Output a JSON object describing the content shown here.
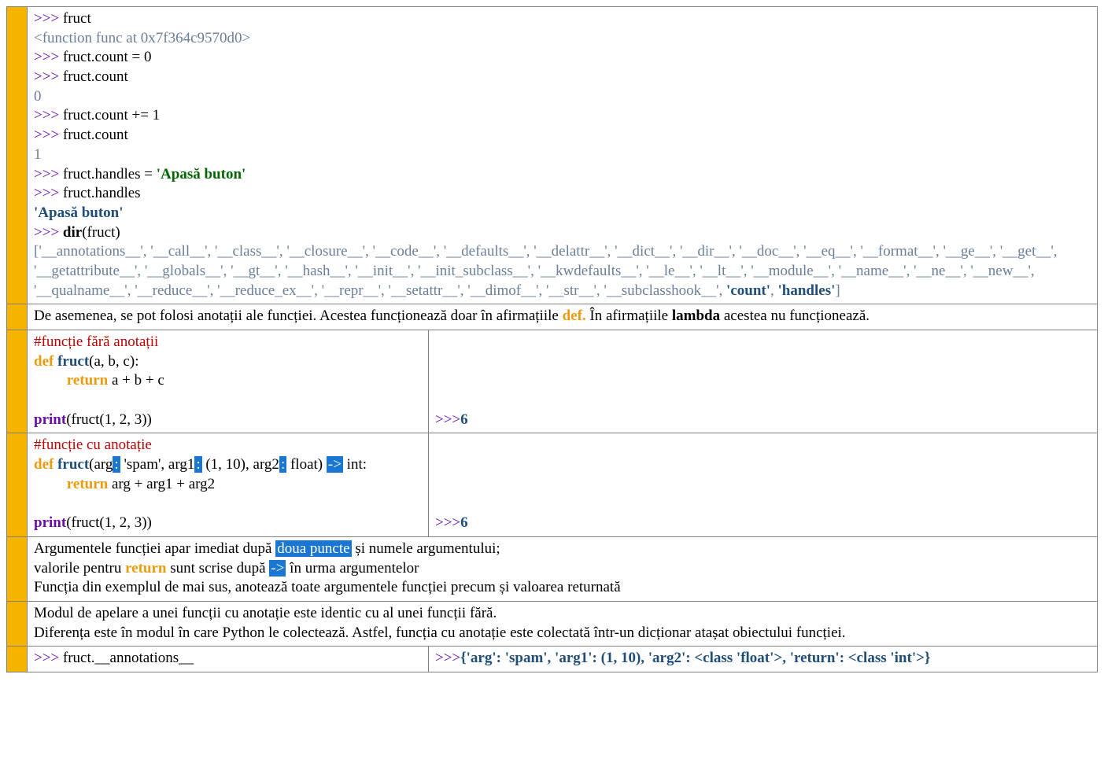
{
  "repl": {
    "l1_prompt": ">>> ",
    "l1_code": "fruct",
    "l2_out": "<function func at 0x7f364c9570d0>",
    "l3_prompt": ">>> ",
    "l3_code": "fruct.count = 0",
    "l4_prompt": ">>> ",
    "l4_code": "fruct.count",
    "l5_out": "0",
    "l6_prompt": ">>> ",
    "l6_code": "fruct.count += 1",
    "l7_prompt": ">>> ",
    "l7_code": "fruct.count",
    "l8_out": "1",
    "l9_prompt": ">>> ",
    "l9_code": "fruct.handles = ",
    "l9_str": "'Apasă buton'",
    "l10_prompt": ">>> ",
    "l10_code": "fruct.handles",
    "l11_out": "'Apasă buton'",
    "l12_prompt": ">>> ",
    "l12_dir": "dir",
    "l12_arg": "(fruct)",
    "dir_list_a": "['__annotations__', '__call__', '__class__', '__closure__', '__code__', '__defaults__', '__delattr__', '__dict__', '__dir__', '__doc__', '__eq__', '__format__', '__ge__', '__get__', '__getattribute__', '__globals__', '__gt__', '__hash__', '__init__', '__init_subclass__', '__kwdefaults__', '__le__', '__lt__', '__module__', '__name__', '__ne__', '__new__', '__qualname__', '__reduce__', '__reduce_ex__', '__repr__', '__setattr__', '__dimof__', '__str__', '__subclasshook__', ",
    "dir_count": "'count'",
    "dir_sep": ", ",
    "dir_handles": "'handles'",
    "dir_close": "]"
  },
  "row2": {
    "text_a": "De asemenea, se pot folosi anotații ale funcției. Acestea funcționează doar în afirmațiile ",
    "def": "def.",
    "text_b": " În afirmațiile ",
    "lambda": "lambda",
    "text_c": " acestea nu funcționează."
  },
  "row3": {
    "comment": "#funcție fără anotații",
    "def": "def ",
    "fn": "fruct",
    "args": "(a, b, c):",
    "ret": "return",
    "retexpr": " a + b + c",
    "print": "print",
    "printarg": "(fruct(1, 2, 3))",
    "out_prompt": ">>>",
    "out_val": "6"
  },
  "row4": {
    "comment": "#funcție cu anotație",
    "def": "def ",
    "fn": "fruct",
    "a_arg": "(arg",
    "colon1": ":",
    "a_spam": " 'spam', arg1",
    "colon2": ":",
    "a_tuple": " (1, 10), arg2",
    "colon3": ":",
    "a_float": " float) ",
    "arrow": "->",
    "a_int": " int:",
    "ret": "return",
    "retexpr": " arg + arg1 + arg2",
    "print": "print",
    "printarg": "(fruct(1, 2, 3))",
    "out_prompt": ">>>",
    "out_val": "6"
  },
  "row5": {
    "l1a": "Argumentele funcției apar imediat după ",
    "hl1": "doua puncte",
    "l1b": " și numele argumentului;",
    "l2a": "valorile pentru ",
    "ret": "return",
    "l2b": " sunt scrise după ",
    "hl2": "->",
    "l2c": " în urma argumentelor",
    "l3": "Funcția din exemplul de mai sus, anotează toate argumentele funcției precum și valoarea returnată"
  },
  "row6": {
    "l1": "Modul de apelare a unei funcții cu anotație este identic cu al unei funcții fără.",
    "l2": "Diferența este în modul în care Python le colectează. Astfel, funcția cu anotație este colectată într-un dicționar atașat obiectului funcției."
  },
  "row7": {
    "prompt": ">>> ",
    "code": "fruct.__annotations__",
    "out_prompt": ">>>",
    "out_val": "{'arg': 'spam', 'arg1': (1, 10), 'arg2': <class 'float'>, 'return': <class 'int'>}"
  }
}
